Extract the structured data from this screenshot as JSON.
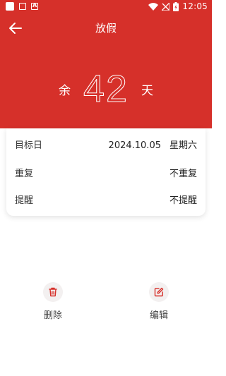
{
  "status_bar": {
    "time": "12:05"
  },
  "header": {
    "title": "放假",
    "prefix": "余",
    "days_left": "42",
    "suffix": "天",
    "background_color": "#d6302a"
  },
  "details": {
    "rows": [
      {
        "label": "目标日",
        "value_date": "2024.10.05",
        "value_weekday": "星期六"
      },
      {
        "label": "重复",
        "value": "不重复"
      },
      {
        "label": "提醒",
        "value": "不提醒"
      }
    ]
  },
  "actions": {
    "delete_label": "删除",
    "edit_label": "编辑",
    "icon_color": "#d6302a"
  }
}
